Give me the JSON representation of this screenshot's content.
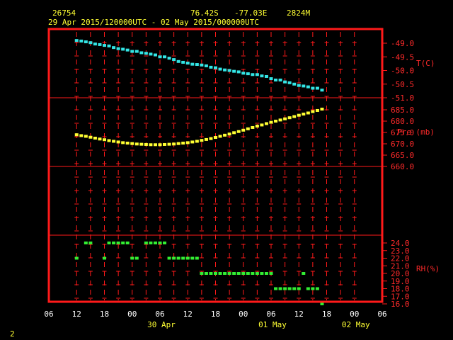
{
  "header": {
    "station_id": "26754",
    "lat": "76.42S",
    "lon": "-77.03E",
    "elevation": "2824M",
    "time_range": "29 Apr 2015/120000UTC - 02 May 2015/000000UTC"
  },
  "footer": {
    "page_number": "2"
  },
  "chart_data": {
    "type": "scatter",
    "x_axis": {
      "ticks_hours": [
        -6,
        0,
        6,
        12,
        18,
        24,
        30,
        36,
        42,
        48,
        54,
        60,
        66
      ],
      "tick_labels": [
        "06",
        "12",
        "18",
        "00",
        "06",
        "12",
        "18",
        "00",
        "06",
        "12",
        "18",
        "00",
        "06"
      ],
      "date_labels": [
        {
          "hour": 18,
          "text": "30 Apr"
        },
        {
          "hour": 42,
          "text": "01 May"
        },
        {
          "hour": 60,
          "text": "02 May"
        }
      ]
    },
    "panels": [
      {
        "name": "T(C)",
        "color": "#33e5e5",
        "ylim": [
          -51.0,
          -48.5
        ],
        "tick_values": [
          -49.0,
          -49.5,
          -50.0,
          -50.5,
          -51.0
        ],
        "tick_labels": [
          "-49.0",
          "-49.5",
          "-50.0",
          "-50.5",
          "-51.0"
        ],
        "series": [
          {
            "x": 0,
            "y": -48.9
          },
          {
            "x": 1,
            "y": -48.92
          },
          {
            "x": 2,
            "y": -48.95
          },
          {
            "x": 3,
            "y": -48.98
          },
          {
            "x": 4,
            "y": -49.03
          },
          {
            "x": 5,
            "y": -49.05
          },
          {
            "x": 6,
            "y": -49.08
          },
          {
            "x": 7,
            "y": -49.1
          },
          {
            "x": 8,
            "y": -49.16
          },
          {
            "x": 9,
            "y": -49.2
          },
          {
            "x": 10,
            "y": -49.22
          },
          {
            "x": 11,
            "y": -49.25
          },
          {
            "x": 12,
            "y": -49.3
          },
          {
            "x": 13,
            "y": -49.3
          },
          {
            "x": 14,
            "y": -49.35
          },
          {
            "x": 15,
            "y": -49.37
          },
          {
            "x": 16,
            "y": -49.4
          },
          {
            "x": 17,
            "y": -49.43
          },
          {
            "x": 18,
            "y": -49.5
          },
          {
            "x": 19,
            "y": -49.5
          },
          {
            "x": 20,
            "y": -49.55
          },
          {
            "x": 21,
            "y": -49.6
          },
          {
            "x": 22,
            "y": -49.67
          },
          {
            "x": 23,
            "y": -49.7
          },
          {
            "x": 24,
            "y": -49.73
          },
          {
            "x": 25,
            "y": -49.77
          },
          {
            "x": 26,
            "y": -49.78
          },
          {
            "x": 27,
            "y": -49.8
          },
          {
            "x": 28,
            "y": -49.83
          },
          {
            "x": 29,
            "y": -49.88
          },
          {
            "x": 30,
            "y": -49.9
          },
          {
            "x": 31,
            "y": -49.95
          },
          {
            "x": 32,
            "y": -49.98
          },
          {
            "x": 33,
            "y": -50.0
          },
          {
            "x": 34,
            "y": -50.03
          },
          {
            "x": 35,
            "y": -50.05
          },
          {
            "x": 36,
            "y": -50.1
          },
          {
            "x": 37,
            "y": -50.12
          },
          {
            "x": 38,
            "y": -50.15
          },
          {
            "x": 39,
            "y": -50.15
          },
          {
            "x": 40,
            "y": -50.2
          },
          {
            "x": 41,
            "y": -50.22
          },
          {
            "x": 42,
            "y": -50.3
          },
          {
            "x": 43,
            "y": -50.35
          },
          {
            "x": 44,
            "y": -50.35
          },
          {
            "x": 45,
            "y": -50.42
          },
          {
            "x": 46,
            "y": -50.45
          },
          {
            "x": 47,
            "y": -50.5
          },
          {
            "x": 48,
            "y": -50.55
          },
          {
            "x": 49,
            "y": -50.57
          },
          {
            "x": 50,
            "y": -50.6
          },
          {
            "x": 51,
            "y": -50.65
          },
          {
            "x": 52,
            "y": -50.65
          },
          {
            "x": 53,
            "y": -50.72
          }
        ]
      },
      {
        "name": "Pre (mb)",
        "color": "#ffff33",
        "ylim": [
          660.0,
          687.0
        ],
        "tick_values": [
          685.0,
          680.0,
          675.0,
          670.0,
          665.0,
          660.0
        ],
        "tick_labels": [
          "685.0",
          "680.0",
          "675.0",
          "670.0",
          "665.0",
          "660.0"
        ],
        "series": [
          {
            "x": 0,
            "y": 674.0
          },
          {
            "x": 1,
            "y": 673.6
          },
          {
            "x": 2,
            "y": 673.3
          },
          {
            "x": 3,
            "y": 672.9
          },
          {
            "x": 4,
            "y": 672.5
          },
          {
            "x": 5,
            "y": 672.1
          },
          {
            "x": 6,
            "y": 671.8
          },
          {
            "x": 7,
            "y": 671.4
          },
          {
            "x": 8,
            "y": 671.1
          },
          {
            "x": 9,
            "y": 670.8
          },
          {
            "x": 10,
            "y": 670.5
          },
          {
            "x": 11,
            "y": 670.3
          },
          {
            "x": 12,
            "y": 670.1
          },
          {
            "x": 13,
            "y": 669.9
          },
          {
            "x": 14,
            "y": 669.8
          },
          {
            "x": 15,
            "y": 669.7
          },
          {
            "x": 16,
            "y": 669.6
          },
          {
            "x": 17,
            "y": 669.6
          },
          {
            "x": 18,
            "y": 669.6
          },
          {
            "x": 19,
            "y": 669.7
          },
          {
            "x": 20,
            "y": 669.8
          },
          {
            "x": 21,
            "y": 669.9
          },
          {
            "x": 22,
            "y": 670.1
          },
          {
            "x": 23,
            "y": 670.3
          },
          {
            "x": 24,
            "y": 670.5
          },
          {
            "x": 25,
            "y": 670.8
          },
          {
            "x": 26,
            "y": 671.1
          },
          {
            "x": 27,
            "y": 671.5
          },
          {
            "x": 28,
            "y": 671.9
          },
          {
            "x": 29,
            "y": 672.3
          },
          {
            "x": 30,
            "y": 672.8
          },
          {
            "x": 31,
            "y": 673.3
          },
          {
            "x": 32,
            "y": 673.8
          },
          {
            "x": 33,
            "y": 674.3
          },
          {
            "x": 34,
            "y": 674.9
          },
          {
            "x": 35,
            "y": 675.4
          },
          {
            "x": 36,
            "y": 676.0
          },
          {
            "x": 37,
            "y": 676.6
          },
          {
            "x": 38,
            "y": 677.2
          },
          {
            "x": 39,
            "y": 677.8
          },
          {
            "x": 40,
            "y": 678.3
          },
          {
            "x": 41,
            "y": 678.9
          },
          {
            "x": 42,
            "y": 679.5
          },
          {
            "x": 43,
            "y": 680.0
          },
          {
            "x": 44,
            "y": 680.5
          },
          {
            "x": 45,
            "y": 681.0
          },
          {
            "x": 46,
            "y": 681.5
          },
          {
            "x": 47,
            "y": 682.0
          },
          {
            "x": 48,
            "y": 682.6
          },
          {
            "x": 49,
            "y": 683.1
          },
          {
            "x": 50,
            "y": 683.6
          },
          {
            "x": 51,
            "y": 684.2
          },
          {
            "x": 52,
            "y": 684.7
          },
          {
            "x": 53,
            "y": 685.3
          }
        ]
      },
      {
        "name": "RH(%)",
        "color": "#33ee33",
        "ylim": [
          16.0,
          24.0
        ],
        "tick_values": [
          24.0,
          23.0,
          22.0,
          21.0,
          20.0,
          19.0,
          18.0,
          17.0,
          16.0
        ],
        "tick_labels": [
          "24.0",
          "23.0",
          "22.0",
          "21.0",
          "20.0",
          "19.0",
          "18.0",
          "17.0",
          "16.0"
        ],
        "series": [
          {
            "x": 0,
            "y": 22
          },
          {
            "x": 2,
            "y": 24
          },
          {
            "x": 3,
            "y": 24
          },
          {
            "x": 6,
            "y": 22
          },
          {
            "x": 7,
            "y": 24
          },
          {
            "x": 8,
            "y": 24
          },
          {
            "x": 9,
            "y": 24
          },
          {
            "x": 10,
            "y": 24
          },
          {
            "x": 11,
            "y": 24
          },
          {
            "x": 12,
            "y": 22
          },
          {
            "x": 13,
            "y": 22
          },
          {
            "x": 15,
            "y": 24
          },
          {
            "x": 16,
            "y": 24
          },
          {
            "x": 17,
            "y": 24
          },
          {
            "x": 18,
            "y": 24
          },
          {
            "x": 19,
            "y": 24
          },
          {
            "x": 20,
            "y": 22
          },
          {
            "x": 21,
            "y": 22
          },
          {
            "x": 22,
            "y": 22
          },
          {
            "x": 23,
            "y": 22
          },
          {
            "x": 24,
            "y": 22
          },
          {
            "x": 25,
            "y": 22
          },
          {
            "x": 26,
            "y": 22
          },
          {
            "x": 27,
            "y": 20
          },
          {
            "x": 28,
            "y": 20
          },
          {
            "x": 29,
            "y": 20
          },
          {
            "x": 30,
            "y": 20
          },
          {
            "x": 31,
            "y": 20
          },
          {
            "x": 32,
            "y": 20
          },
          {
            "x": 33,
            "y": 20
          },
          {
            "x": 34,
            "y": 20
          },
          {
            "x": 35,
            "y": 20
          },
          {
            "x": 36,
            "y": 20
          },
          {
            "x": 37,
            "y": 20
          },
          {
            "x": 38,
            "y": 20
          },
          {
            "x": 39,
            "y": 20
          },
          {
            "x": 40,
            "y": 20
          },
          {
            "x": 41,
            "y": 20
          },
          {
            "x": 42,
            "y": 20
          },
          {
            "x": 43,
            "y": 18
          },
          {
            "x": 44,
            "y": 18
          },
          {
            "x": 45,
            "y": 18
          },
          {
            "x": 46,
            "y": 18
          },
          {
            "x": 47,
            "y": 18
          },
          {
            "x": 48,
            "y": 18
          },
          {
            "x": 49,
            "y": 20
          },
          {
            "x": 50,
            "y": 18
          },
          {
            "x": 51,
            "y": 18
          },
          {
            "x": 52,
            "y": 18
          },
          {
            "x": 53,
            "y": 16
          }
        ]
      }
    ],
    "grid": true
  }
}
